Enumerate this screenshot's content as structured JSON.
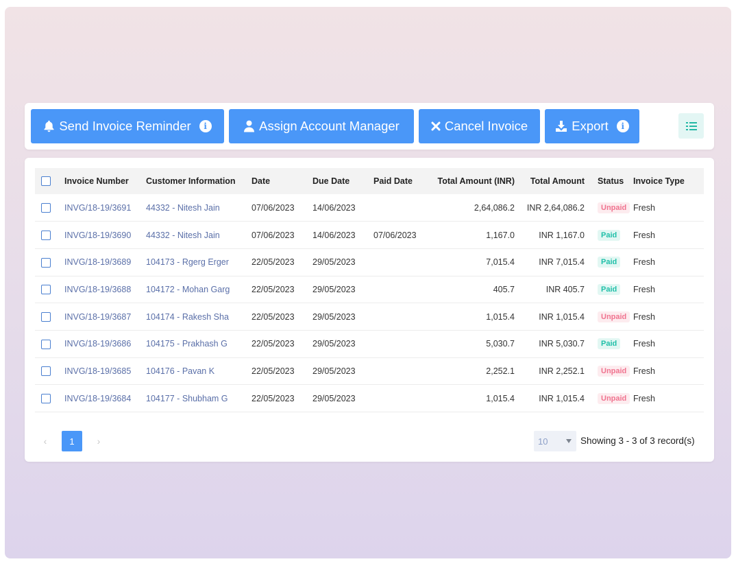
{
  "toolbar": {
    "send_reminder_label": "Send Invoice Reminder",
    "assign_manager_label": "Assign Account Manager",
    "cancel_invoice_label": "Cancel Invoice",
    "export_label": "Export",
    "info_glyph": "i"
  },
  "table": {
    "headers": {
      "invoice_number": "Invoice Number",
      "customer_information": "Customer Information",
      "date": "Date",
      "due_date": "Due Date",
      "paid_date": "Paid Date",
      "total_amount_inr": "Total Amount (INR)",
      "total_amount": "Total Amount",
      "status": "Status",
      "invoice_type": "Invoice Type"
    },
    "rows": [
      {
        "invoice": "INVG/18-19/3691",
        "customer": "44332 - Nitesh Jain",
        "date": "07/06/2023",
        "due": "14/06/2023",
        "paid": "",
        "total_inr": "2,64,086.2",
        "total": "INR 2,64,086.2",
        "status": "Unpaid",
        "type": "Fresh"
      },
      {
        "invoice": "INVG/18-19/3690",
        "customer": "44332 - Nitesh Jain",
        "date": "07/06/2023",
        "due": "14/06/2023",
        "paid": "07/06/2023",
        "total_inr": "1,167.0",
        "total": "INR 1,167.0",
        "status": "Paid",
        "type": "Fresh"
      },
      {
        "invoice": "INVG/18-19/3689",
        "customer": "104173 - Rgerg Erger",
        "date": "22/05/2023",
        "due": "29/05/2023",
        "paid": "",
        "total_inr": "7,015.4",
        "total": "INR 7,015.4",
        "status": "Paid",
        "type": "Fresh"
      },
      {
        "invoice": "INVG/18-19/3688",
        "customer": "104172 - Mohan Garg",
        "date": "22/05/2023",
        "due": "29/05/2023",
        "paid": "",
        "total_inr": "405.7",
        "total": "INR 405.7",
        "status": "Paid",
        "type": "Fresh"
      },
      {
        "invoice": "INVG/18-19/3687",
        "customer": "104174 - Rakesh Sha",
        "date": "22/05/2023",
        "due": "29/05/2023",
        "paid": "",
        "total_inr": "1,015.4",
        "total": "INR 1,015.4",
        "status": "Unpaid",
        "type": "Fresh"
      },
      {
        "invoice": "INVG/18-19/3686",
        "customer": "104175 - Prakhash G",
        "date": "22/05/2023",
        "due": "29/05/2023",
        "paid": "",
        "total_inr": "5,030.7",
        "total": "INR 5,030.7",
        "status": "Paid",
        "type": "Fresh"
      },
      {
        "invoice": "INVG/18-19/3685",
        "customer": "104176 - Pavan K",
        "date": "22/05/2023",
        "due": "29/05/2023",
        "paid": "",
        "total_inr": "2,252.1",
        "total": "INR 2,252.1",
        "status": "Unpaid",
        "type": "Fresh"
      },
      {
        "invoice": "INVG/18-19/3684",
        "customer": "104177 - Shubham G",
        "date": "22/05/2023",
        "due": "29/05/2023",
        "paid": "",
        "total_inr": "1,015.4",
        "total": "INR 1,015.4",
        "status": "Unpaid",
        "type": "Fresh"
      }
    ]
  },
  "pagination": {
    "prev_glyph": "‹",
    "current_page": "1",
    "next_glyph": "›",
    "page_size": "10",
    "showing_text": "Showing 3 - 3 of 3 record(s)"
  },
  "icons": {
    "send_reminder": "bell-icon",
    "assign_manager": "user-icon",
    "cancel_invoice": "x-icon",
    "export": "download-icon",
    "info": "info-icon",
    "list_toggle": "list-icon"
  },
  "colors": {
    "primary": "#4a97f8",
    "link": "#5a6fa8",
    "paid": "#1fbfa8",
    "unpaid": "#f0738f",
    "list_toggle_bg": "#e3f6f4"
  }
}
